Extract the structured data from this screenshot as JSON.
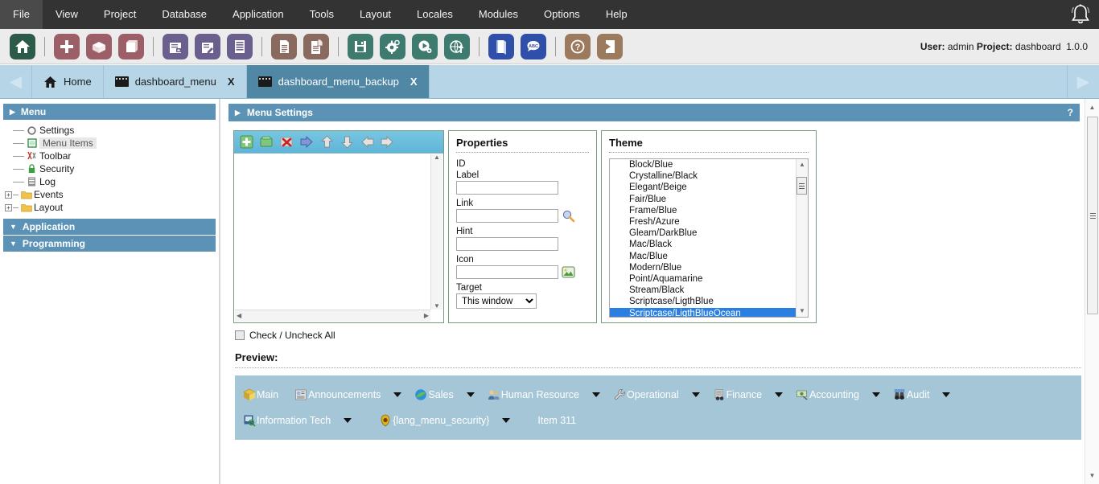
{
  "menubar": {
    "items": [
      {
        "label": "File"
      },
      {
        "label": "View"
      },
      {
        "label": "Project"
      },
      {
        "label": "Database"
      },
      {
        "label": "Application"
      },
      {
        "label": "Tools"
      },
      {
        "label": "Layout"
      },
      {
        "label": "Locales"
      },
      {
        "label": "Modules"
      },
      {
        "label": "Options"
      },
      {
        "label": "Help"
      }
    ],
    "notification_icon": "bell-icon"
  },
  "toolbar": {
    "buttons": [
      {
        "name": "home-icon",
        "color": "#2c5b4a"
      },
      {
        "name": "new-application-icon",
        "color": "#9c5f68"
      },
      {
        "name": "open-package-icon",
        "color": "#9c5f68"
      },
      {
        "name": "archive-box-icon",
        "color": "#9c5f68"
      },
      {
        "name": "new-form-icon",
        "color": "#6b5f8e"
      },
      {
        "name": "edit-form-icon",
        "color": "#6b5f8e"
      },
      {
        "name": "grid-icon",
        "color": "#6b5f8e"
      },
      {
        "name": "document-icon",
        "color": "#8a6a5e"
      },
      {
        "name": "document-copy-icon",
        "color": "#8a6a5e"
      },
      {
        "name": "save-icon",
        "color": "#3e7a6e"
      },
      {
        "name": "settings-gear-icon",
        "color": "#3e7a6e"
      },
      {
        "name": "run-icon",
        "color": "#3e7a6e"
      },
      {
        "name": "publish-icon",
        "color": "#3e7a6e"
      },
      {
        "name": "book-icon",
        "color": "#2f4fa8"
      },
      {
        "name": "abc-translate-icon",
        "color": "#2f4fa8"
      },
      {
        "name": "help-icon",
        "color": "#9b7a5e"
      },
      {
        "name": "exit-icon",
        "color": "#9b7a5e"
      }
    ],
    "status": {
      "user_label": "User:",
      "user_value": "admin",
      "project_label": "Project:",
      "project_value": "dashboard",
      "version": "1.0.0"
    }
  },
  "tabs": {
    "prev_arrow": "◀",
    "next_arrow": "▶",
    "items": [
      {
        "label": "Home",
        "icon": "home-icon",
        "closable": false,
        "active": false
      },
      {
        "label": "dashboard_menu",
        "icon": "window-icon",
        "closable": true,
        "close_label": "X",
        "active": false
      },
      {
        "label": "dashboard_menu_backup",
        "icon": "window-icon",
        "closable": true,
        "close_label": "X",
        "active": true
      }
    ]
  },
  "sidebar": {
    "groups": [
      {
        "label": "Menu",
        "expanded": true,
        "marker": "▶",
        "items": [
          {
            "label": "Settings",
            "icon": "gear-icon",
            "selected": false,
            "expandable": false
          },
          {
            "label": "Menu Items",
            "icon": "menu-items-icon",
            "selected": true,
            "expandable": false
          },
          {
            "label": "Toolbar",
            "icon": "toolbar-icon",
            "selected": false,
            "expandable": false
          },
          {
            "label": "Security",
            "icon": "lock-icon",
            "selected": false,
            "expandable": false
          },
          {
            "label": "Log",
            "icon": "log-icon",
            "selected": false,
            "expandable": false
          },
          {
            "label": "Events",
            "icon": "folder-icon",
            "selected": false,
            "expandable": true,
            "expander": "+"
          },
          {
            "label": "Layout",
            "icon": "folder-icon",
            "selected": false,
            "expandable": true,
            "expander": "+"
          }
        ]
      },
      {
        "label": "Application",
        "expanded": false,
        "marker": "▼",
        "items": []
      },
      {
        "label": "Programming",
        "expanded": false,
        "marker": "▼",
        "items": []
      }
    ]
  },
  "main": {
    "header": {
      "title": "Menu Settings",
      "marker": "▶",
      "help": "?"
    },
    "items_panel": {
      "tools": [
        {
          "name": "add-item-icon"
        },
        {
          "name": "add-folder-icon"
        },
        {
          "name": "delete-item-icon"
        },
        {
          "name": "move-right-icon"
        },
        {
          "name": "move-up-icon"
        },
        {
          "name": "move-down-icon"
        },
        {
          "name": "outdent-icon"
        },
        {
          "name": "indent-icon"
        }
      ],
      "items": []
    },
    "properties": {
      "title": "Properties",
      "fields": [
        {
          "label": "ID",
          "value": "",
          "type": "readonly"
        },
        {
          "label": "Label",
          "value": "",
          "type": "text"
        },
        {
          "label": "Link",
          "value": "",
          "type": "text",
          "button": "link-picker-icon"
        },
        {
          "label": "Hint",
          "value": "",
          "type": "text"
        },
        {
          "label": "Icon",
          "value": "",
          "type": "text",
          "button": "image-picker-icon"
        },
        {
          "label": "Target",
          "value": "This window",
          "type": "select"
        }
      ],
      "target_options": [
        "This window"
      ]
    },
    "theme": {
      "title": "Theme",
      "options": [
        "Block/Blue",
        "Crystalline/Black",
        "Elegant/Beige",
        "Fair/Blue",
        "Frame/Blue",
        "Fresh/Azure",
        "Gleam/DarkBlue",
        "Mac/Black",
        "Mac/Blue",
        "Modern/Blue",
        "Point/Aquamarine",
        "Stream/Black",
        "Scriptcase/LigthBlue",
        "Scriptcase/LigthBlueOcean"
      ],
      "selected": "Scriptcase/LigthBlueOcean",
      "selected_color": "#2a7fe0"
    },
    "check_all": {
      "label": "Check / Uncheck All",
      "checked": false
    },
    "preview": {
      "label": "Preview:",
      "background": "#a5c6d6",
      "rows": [
        [
          {
            "label": "Main",
            "icon": "cube-icon",
            "has_caret": false
          },
          {
            "label": "Announcements",
            "icon": "announcements-icon",
            "has_caret": true
          },
          {
            "label": "Sales",
            "icon": "sales-icon",
            "has_caret": true
          },
          {
            "label": "Human Resource",
            "icon": "people-icon",
            "has_caret": true
          },
          {
            "label": "Operational",
            "icon": "wrench-icon",
            "has_caret": true
          },
          {
            "label": "Finance",
            "icon": "finance-icon",
            "has_caret": true
          },
          {
            "label": "Accounting",
            "icon": "money-icon",
            "has_caret": true
          },
          {
            "label": "Audit",
            "icon": "binoculars-icon",
            "has_caret": true
          }
        ],
        [
          {
            "label": "Information Tech",
            "icon": "it-icon",
            "has_caret": true
          },
          {
            "label": "{lang_menu_security}",
            "icon": "shield-icon",
            "has_caret": true
          },
          {
            "label": "Item 311",
            "icon": null,
            "has_caret": false,
            "plain": true
          }
        ]
      ]
    }
  }
}
